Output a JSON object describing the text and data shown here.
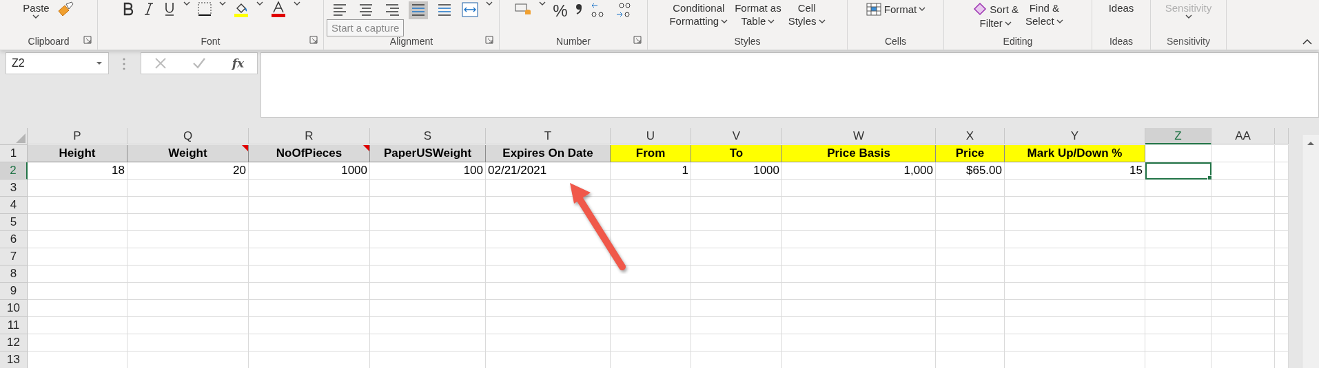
{
  "ribbon": {
    "groups": [
      {
        "label": "Clipboard",
        "launcher": true,
        "commands": [
          {
            "top": "Paste"
          }
        ]
      },
      {
        "label": "Font",
        "launcher": true
      },
      {
        "label": "Alignment",
        "launcher": true,
        "tools": [
          {
            "selected": false
          },
          {
            "selected": false
          },
          {
            "selected": false
          },
          {
            "selected": true
          },
          {
            "selected": false
          }
        ]
      },
      {
        "label": "Number",
        "launcher": true,
        "commands": [
          {
            "top": "%"
          }
        ]
      },
      {
        "label": "Styles",
        "launcher": false,
        "commands": [
          {
            "top": "Conditional",
            "bottom": "Formatting"
          },
          {
            "top": "Format as",
            "bottom": "Table"
          },
          {
            "top": "Cell",
            "bottom": "Styles"
          }
        ]
      },
      {
        "label": "Cells",
        "launcher": false,
        "commands": [
          {
            "top": "Format"
          }
        ]
      },
      {
        "label": "Editing",
        "launcher": false,
        "commands": [
          {
            "top": "Sort &",
            "bottom": "Filter"
          },
          {
            "top": "Find &",
            "bottom": "Select"
          }
        ]
      },
      {
        "label": "Ideas",
        "launcher": false,
        "commands": [
          {
            "top": "Ideas"
          }
        ]
      },
      {
        "label": "Sensitivity",
        "launcher": false,
        "disabled": true,
        "commands": [
          {
            "top": "Sensitivity"
          }
        ]
      }
    ]
  },
  "tooltip": "Start a capture",
  "formula_bar": {
    "name_box": "Z2",
    "function_label": "fx"
  },
  "sheet": {
    "columns": [
      {
        "label": "P",
        "selected": false
      },
      {
        "label": "Q",
        "selected": false
      },
      {
        "label": "R",
        "selected": false
      },
      {
        "label": "S",
        "selected": false
      },
      {
        "label": "T",
        "selected": false
      },
      {
        "label": "U",
        "selected": false
      },
      {
        "label": "V",
        "selected": false
      },
      {
        "label": "W",
        "selected": false
      },
      {
        "label": "X",
        "selected": false
      },
      {
        "label": "Y",
        "selected": false
      },
      {
        "label": "Z",
        "selected": true
      },
      {
        "label": "AA",
        "selected": false
      }
    ],
    "rows": [
      {
        "number": "1",
        "selected": false,
        "cells": [
          {
            "text": "Height",
            "color": "#d9d9d9",
            "comment": false
          },
          {
            "text": "Weight",
            "color": "#d9d9d9",
            "comment": true
          },
          {
            "text": "NoOfPieces",
            "color": "#d9d9d9",
            "comment": true
          },
          {
            "text": "PaperUSWeight",
            "color": "#d9d9d9",
            "comment": false
          },
          {
            "text": "Expires On Date",
            "color": "#d9d9d9",
            "comment": false
          },
          {
            "text": "From",
            "color": "#ffff00",
            "comment": false
          },
          {
            "text": "To",
            "color": "#ffff00",
            "comment": false
          },
          {
            "text": "Price Basis",
            "color": "#ffff00",
            "comment": false
          },
          {
            "text": "Price",
            "color": "#ffff00",
            "comment": false
          },
          {
            "text": "Mark Up/Down %",
            "color": "#ffff00",
            "comment": false
          }
        ]
      },
      {
        "number": "2",
        "selected": true,
        "cells": [
          {
            "text": "18",
            "kind": "number"
          },
          {
            "text": "20",
            "kind": "number"
          },
          {
            "text": "1000",
            "kind": "number"
          },
          {
            "text": "100",
            "kind": "number"
          },
          {
            "text": "02/21/2021",
            "kind": "text"
          },
          {
            "text": "1",
            "kind": "number"
          },
          {
            "text": "1000",
            "kind": "number"
          },
          {
            "text": "1,000",
            "kind": "number"
          },
          {
            "text": "$65.00",
            "kind": "number"
          },
          {
            "text": "15",
            "kind": "number"
          },
          {
            "kind": "active"
          }
        ]
      },
      {
        "number": "3",
        "selected": false
      },
      {
        "number": "4",
        "selected": false
      },
      {
        "number": "5",
        "selected": false
      },
      {
        "number": "6",
        "selected": false
      },
      {
        "number": "7",
        "selected": false
      },
      {
        "number": "8",
        "selected": false
      },
      {
        "number": "9",
        "selected": false
      },
      {
        "number": "10",
        "selected": false
      },
      {
        "number": "11",
        "selected": false
      },
      {
        "number": "12",
        "selected": false
      },
      {
        "number": "13",
        "selected": false
      }
    ]
  }
}
